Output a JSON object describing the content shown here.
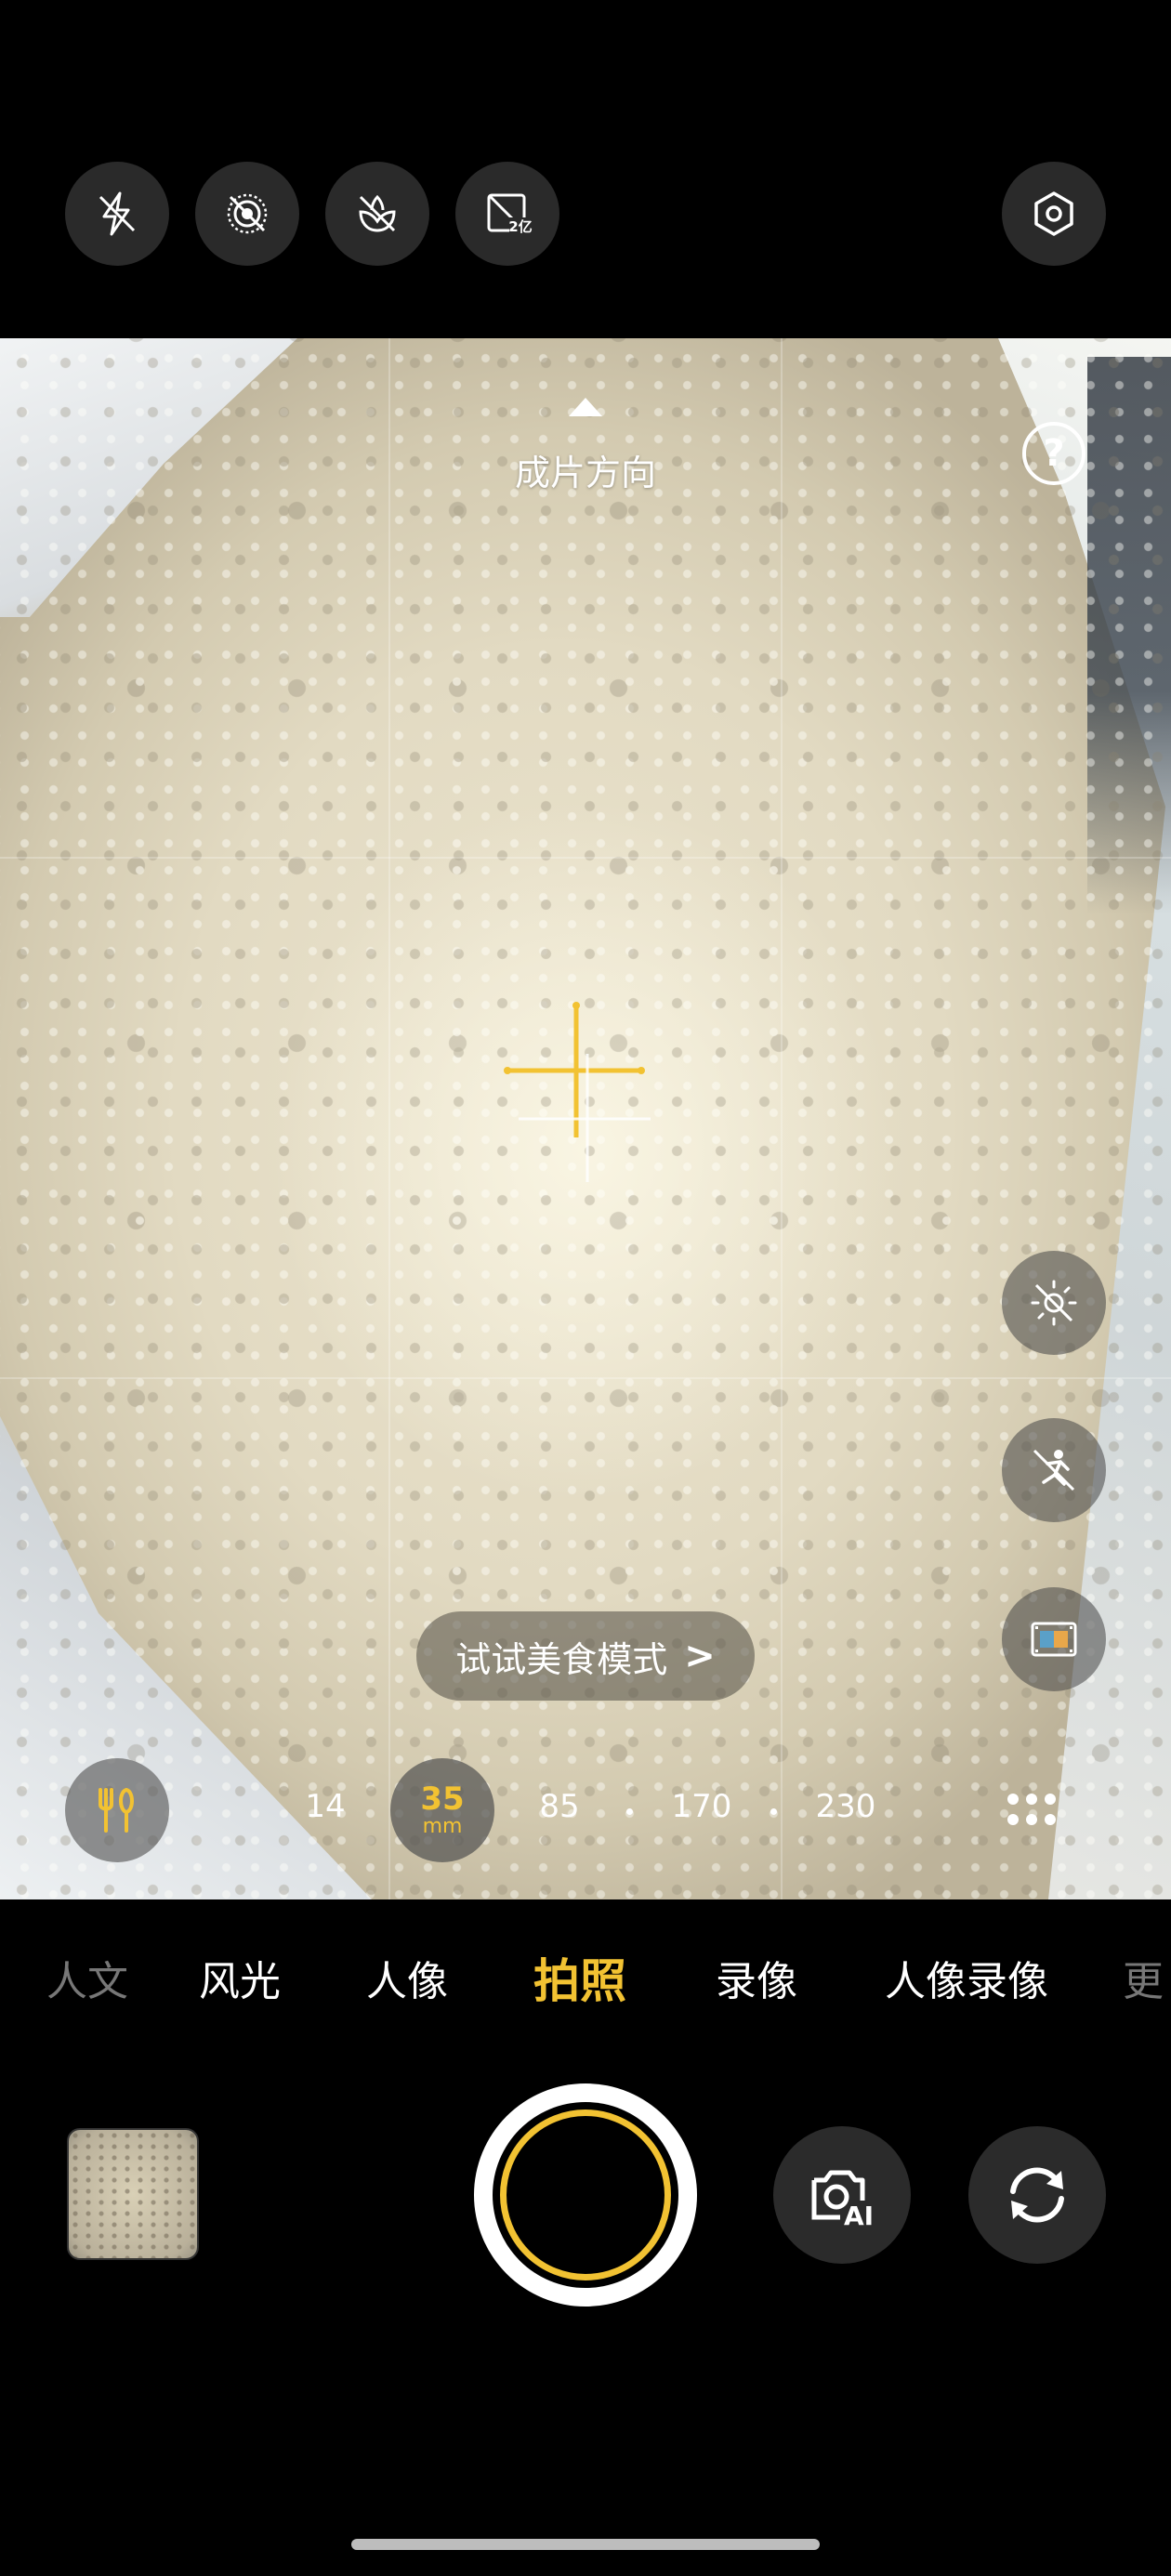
{
  "top_controls": {
    "flash_icon": "flash-off-icon",
    "live_photo_icon": "live-photo-off-icon",
    "macro_icon": "macro-off-icon",
    "resolution_icon": "resolution-200mp-icon",
    "resolution_label": "2亿",
    "settings_icon": "settings-hexagon-icon"
  },
  "viewfinder": {
    "orientation_label": "成片方向",
    "help_label": "?",
    "food_mode_tip": "试试美食模式",
    "food_mode_chevron": ">"
  },
  "zoom": {
    "options": [
      "14",
      "35",
      "85",
      "170",
      "230"
    ],
    "active_value": "35",
    "active_unit": "mm"
  },
  "modes": [
    "人文",
    "风光",
    "人像",
    "拍照",
    "录像",
    "人像录像",
    "更"
  ],
  "active_mode": "拍照",
  "colors": {
    "accent": "#f2c232",
    "background": "#000000"
  }
}
